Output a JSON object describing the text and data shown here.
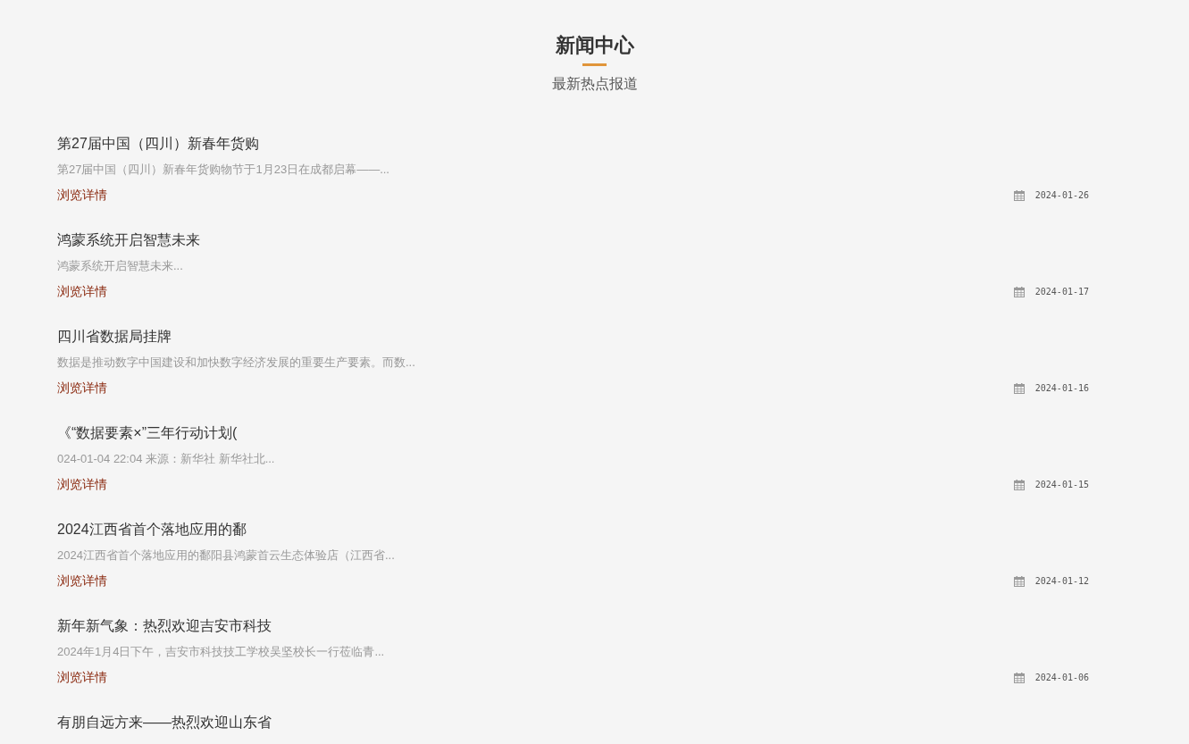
{
  "header": {
    "title": "新闻中心",
    "subtitle": "最新热点报道"
  },
  "news": [
    {
      "title": "第27届中国（四川）新春年货购",
      "summary": "第27届中国（四川）新春年货购物节于1月23日在成都启幕——...",
      "link": "浏览详情",
      "date": "2024-01-26"
    },
    {
      "title": "鸿蒙系统开启智慧未来",
      "summary": "鸿蒙系统开启智慧未来...",
      "link": "浏览详情",
      "date": "2024-01-17"
    },
    {
      "title": "四川省数据局挂牌",
      "summary": "数据是推动数字中国建设和加快数字经济发展的重要生产要素。而数...",
      "link": "浏览详情",
      "date": "2024-01-16"
    },
    {
      "title": "《“数据要素×”三年行动计划(",
      "summary": "024-01-04 22:04 来源：新华社 新华社北...",
      "link": "浏览详情",
      "date": "2024-01-15"
    },
    {
      "title": "2024江西省首个落地应用的鄱",
      "summary": "2024江西省首个落地应用的鄱阳县鸿蒙首云生态体验店（江西省...",
      "link": "浏览详情",
      "date": "2024-01-12"
    },
    {
      "title": "新年新气象：热烈欢迎吉安市科技",
      "summary": "2024年1月4日下午，吉安市科技技工学校吴坚校长一行莅临青...",
      "link": "浏览详情",
      "date": "2024-01-06"
    },
    {
      "title": "有朋自远方来——热烈欢迎山东省"
    }
  ]
}
